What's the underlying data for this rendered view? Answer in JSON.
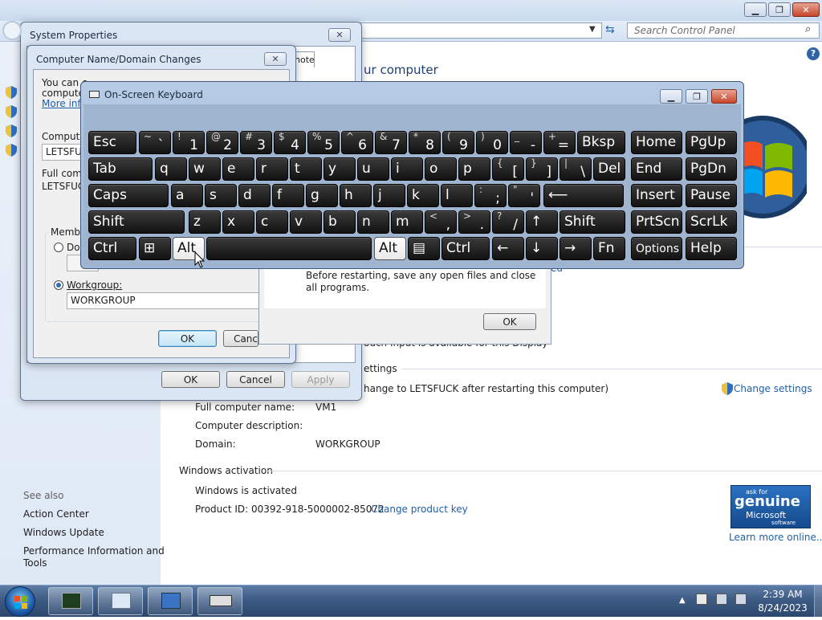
{
  "control_panel": {
    "search_placeholder": "Search Control Panel",
    "heading_partial": "ur computer",
    "left_nav": {
      "see_also": "See also",
      "links": [
        "Action Center",
        "Windows Update",
        "Performance Information and",
        "Tools"
      ]
    },
    "behind_dialog_partial": "ouch Input is available for this Display",
    "settings_header_partial": "ettings",
    "rename_notice": "hange to LETSFUCK after restarting this computer)",
    "change_settings": "Change settings",
    "full_computer_name_label": "Full computer name:",
    "full_computer_name_value": "VM1",
    "computer_description_label": "Computer description:",
    "domain_label": "Domain:",
    "domain_value": "WORKGROUP",
    "activation_header": "Windows activation",
    "activation_status": "Windows is activated",
    "product_id": "Product ID: 00392-918-5000002-85072",
    "change_product_key": "Change product key",
    "genuine_badge": {
      "line1": "ask for",
      "line2": "genuine",
      "line3": "Microsoft",
      "line4": "software"
    },
    "learn_more": "Learn more online..."
  },
  "system_properties": {
    "title": "System Properties",
    "tab_partial": "note",
    "ok": "OK",
    "cancel": "Cancel",
    "apply": "Apply"
  },
  "name_changes": {
    "title": "Computer Name/Domain Changes",
    "intro_1": "You can c",
    "intro_2": "computer.",
    "more_info": "More infor",
    "computer_label": "Computer",
    "computer_value": "LETSFUCK",
    "full_label": "Full compu",
    "full_value": "LETSFUCK",
    "member_of": "Member",
    "domain_option": "Dom",
    "workgroup_option": "Workgroup:",
    "workgroup_value": "WORKGROUP",
    "ok": "OK",
    "cancel_partial": "Canc"
  },
  "restart_dialog": {
    "message": "Before restarting, save any open files and close all programs.",
    "ok": "OK",
    "link_partial": "ed"
  },
  "osk": {
    "title": "On-Screen Keyboard",
    "rows": [
      [
        {
          "t": "Esc"
        },
        {
          "u": "~",
          "l": "`"
        },
        {
          "u": "!",
          "l": "1"
        },
        {
          "u": "@",
          "l": "2"
        },
        {
          "u": "#",
          "l": "3"
        },
        {
          "u": "$",
          "l": "4"
        },
        {
          "u": "%",
          "l": "5"
        },
        {
          "u": "^",
          "l": "6"
        },
        {
          "u": "&",
          "l": "7"
        },
        {
          "u": "*",
          "l": "8"
        },
        {
          "u": "(",
          "l": "9"
        },
        {
          "u": ")",
          "l": "0"
        },
        {
          "u": "_",
          "l": "-"
        },
        {
          "u": "+",
          "l": "="
        },
        {
          "t": "Bksp"
        },
        {
          "t": "Home"
        },
        {
          "t": "PgUp"
        }
      ],
      [
        {
          "t": "Tab"
        },
        {
          "t": "q"
        },
        {
          "t": "w"
        },
        {
          "t": "e"
        },
        {
          "t": "r"
        },
        {
          "t": "t"
        },
        {
          "t": "y"
        },
        {
          "t": "u"
        },
        {
          "t": "i"
        },
        {
          "t": "o"
        },
        {
          "t": "p"
        },
        {
          "u": "{",
          "l": "["
        },
        {
          "u": "}",
          "l": "]"
        },
        {
          "u": "|",
          "l": "\\"
        },
        {
          "t": "Del"
        },
        {
          "t": "End"
        },
        {
          "t": "PgDn"
        }
      ],
      [
        {
          "t": "Caps"
        },
        {
          "t": "a"
        },
        {
          "t": "s"
        },
        {
          "t": "d"
        },
        {
          "t": "f"
        },
        {
          "t": "g"
        },
        {
          "t": "h"
        },
        {
          "t": "j"
        },
        {
          "t": "k"
        },
        {
          "t": "l"
        },
        {
          "u": ":",
          "l": ";"
        },
        {
          "u": "\"",
          "l": "'"
        },
        {
          "t": "⟵"
        },
        {
          "t": "Insert"
        },
        {
          "t": "Pause"
        }
      ],
      [
        {
          "t": "Shift"
        },
        {
          "t": "z"
        },
        {
          "t": "x"
        },
        {
          "t": "c"
        },
        {
          "t": "v"
        },
        {
          "t": "b"
        },
        {
          "t": "n"
        },
        {
          "t": "m"
        },
        {
          "u": "<",
          "l": ","
        },
        {
          "u": ">",
          "l": "."
        },
        {
          "u": "?",
          "l": "/"
        },
        {
          "t": "↑"
        },
        {
          "t": "Shift"
        },
        {
          "t": "PrtScn"
        },
        {
          "t": "ScrLk"
        }
      ],
      [
        {
          "t": "Ctrl"
        },
        {
          "t": "⊞"
        },
        {
          "t": "Alt"
        },
        {
          "t": ""
        },
        {
          "t": "Alt"
        },
        {
          "t": "▤"
        },
        {
          "t": "Ctrl"
        },
        {
          "t": "←"
        },
        {
          "t": "↓"
        },
        {
          "t": "→"
        },
        {
          "t": "Fn"
        },
        {
          "t": "Options"
        },
        {
          "t": "Help"
        }
      ]
    ]
  },
  "taskbar": {
    "time": "2:39 AM",
    "date": "8/24/2023"
  },
  "colors": {
    "link": "#1f5fa8",
    "taskbar": "#3d5b84",
    "osk_frame": "#9fb4cf",
    "key": "#1a1a1a"
  }
}
